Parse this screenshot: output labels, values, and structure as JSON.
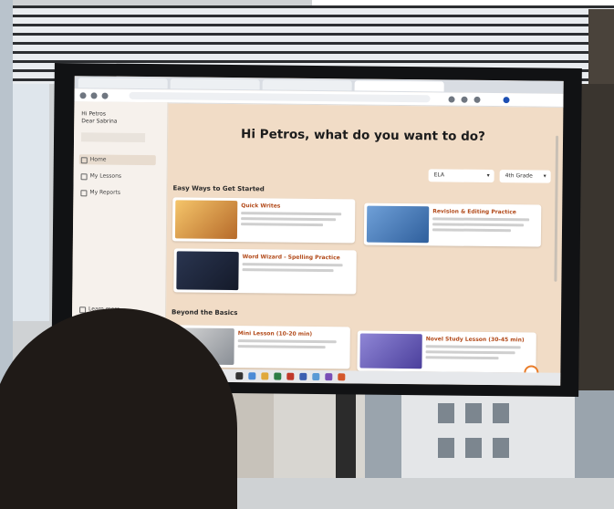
{
  "page": {
    "greeting": "Hi Petros, what do you want to do?",
    "section_get_started": "Easy Ways to Get Started",
    "section_beyond": "Beyond the Basics"
  },
  "sidebar": {
    "user_line1": "Hi Petros",
    "user_line2": "Dear Sabrina",
    "items": [
      {
        "label": "Home",
        "icon": "home-icon"
      },
      {
        "label": "My Lessons",
        "icon": "book-icon"
      },
      {
        "label": "My Reports",
        "icon": "chart-icon"
      }
    ],
    "bottom_item": "Learn more"
  },
  "filters": {
    "subject": "ELA",
    "grade": "4th Grade"
  },
  "cards": {
    "get_started": [
      {
        "title": "Quick Writes"
      },
      {
        "title": "Revision & Editing Practice"
      },
      {
        "title": "Word Wizard - Spelling Practice"
      }
    ],
    "beyond": [
      {
        "title": "Mini Lesson (10-20 min)"
      },
      {
        "title": "Novel Study Lesson (30-45 min)"
      }
    ]
  },
  "colors": {
    "page_bg": "#f1dcc6",
    "card_title": "#b24a1a",
    "notification_ring": "#e97d2b"
  }
}
